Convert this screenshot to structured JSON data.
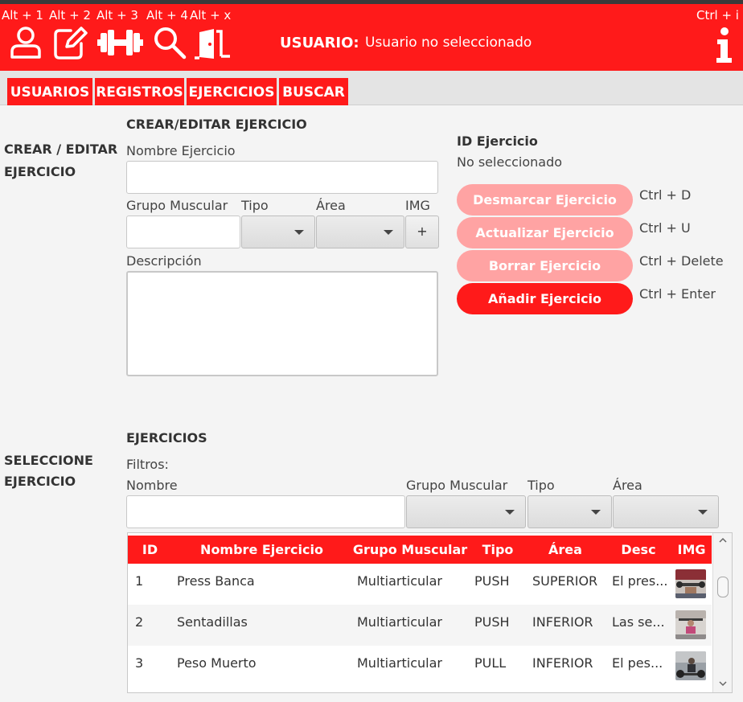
{
  "header": {
    "shortcuts": [
      "Alt + 1",
      "Alt + 2",
      "Alt + 3",
      "Alt + 4",
      "Alt + x"
    ],
    "info_shortcut": "Ctrl + i",
    "icons": [
      "user-icon",
      "edit-icon",
      "dumbbell-icon",
      "search-icon",
      "exit-door-icon",
      "info-icon"
    ],
    "user_label": "USUARIO:",
    "user_value": "Usuario no seleccionado"
  },
  "tabs": [
    "USUARIOS",
    "REGISTROS",
    "EJERCICIOS",
    "BUSCAR"
  ],
  "edit_section": {
    "side_label_1": "CREAR / EDITAR",
    "side_label_2": "EJERCICIO",
    "title": "CREAR/EDITAR EJERCICIO",
    "name_label": "Nombre Ejercicio",
    "name_value": "",
    "group_label": "Grupo Muscular",
    "group_value": "",
    "type_label": "Tipo",
    "type_value": "",
    "area_label": "Área",
    "area_value": "",
    "img_label": "IMG",
    "img_button": "+",
    "desc_label": "Descripción",
    "desc_value": ""
  },
  "id_panel": {
    "title": "ID Ejercicio",
    "value": "No seleccionado"
  },
  "actions": [
    {
      "label": "Desmarcar Ejercicio",
      "shortcut": "Ctrl + D"
    },
    {
      "label": "Actualizar Ejercicio",
      "shortcut": "Ctrl + U"
    },
    {
      "label": "Borrar Ejercicio",
      "shortcut": "Ctrl + Delete"
    },
    {
      "label": "Añadir Ejercicio",
      "shortcut": "Ctrl + Enter"
    }
  ],
  "select_section": {
    "side_label_1": "SELECCIONE",
    "side_label_2": "EJERCICIO",
    "title": "EJERCICIOS",
    "filters_label": "Filtros:",
    "name_label": "Nombre",
    "name_value": "",
    "group_label": "Grupo Muscular",
    "type_label": "Tipo",
    "area_label": "Área"
  },
  "table": {
    "columns": [
      "ID",
      "Nombre Ejercicio",
      "Grupo Muscular",
      "Tipo",
      "Área",
      "Desc",
      "IMG"
    ],
    "rows": [
      {
        "id": "1",
        "name": "Press Banca",
        "group": "Multiarticular",
        "type": "PUSH",
        "area": "SUPERIOR",
        "desc": "El pres..."
      },
      {
        "id": "2",
        "name": "Sentadillas",
        "group": "Multiarticular",
        "type": "PUSH",
        "area": "INFERIOR",
        "desc": "Las se..."
      },
      {
        "id": "3",
        "name": "Peso Muerto",
        "group": "Multiarticular",
        "type": "PULL",
        "area": "INFERIOR",
        "desc": "El pes..."
      }
    ]
  },
  "colors": {
    "accent": "#ff1a1a",
    "disabled_button": "#ffa3a3",
    "background": "#f4f4f4"
  }
}
